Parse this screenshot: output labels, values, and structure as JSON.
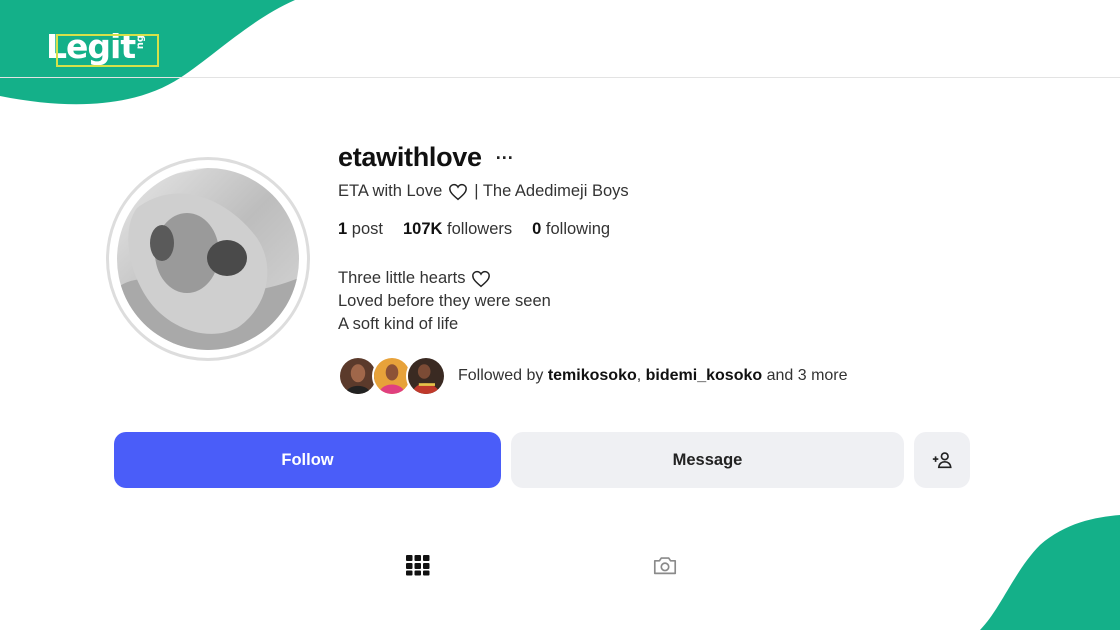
{
  "brand": {
    "logo_text": "Legit",
    "logo_suffix": "ng",
    "brand_color": "#14b089",
    "accent_frame_color": "#d6e14a"
  },
  "profile": {
    "username": "etawithlove",
    "more_label": "···",
    "full_name": "ETA with Love",
    "full_name_suffix": "| The Adedimeji Boys",
    "stats": {
      "posts_count": "1",
      "posts_label": "post",
      "followers_count": "107K",
      "followers_label": "followers",
      "following_count": "0",
      "following_label": "following"
    },
    "bio": {
      "line1": "Three little hearts",
      "line2": "Loved before they were seen",
      "line3": "A soft kind of life"
    },
    "followed_by": {
      "prefix": "Followed by",
      "user1": "temikosoko",
      "separator": ",",
      "user2": "bidemi_kosoko",
      "suffix": "and 3 more"
    }
  },
  "actions": {
    "follow_label": "Follow",
    "message_label": "Message",
    "suggest_icon": "person-add-icon",
    "follow_color": "#4a5df9"
  },
  "tabs": [
    {
      "icon": "grid-icon"
    },
    {
      "icon": "tagged-camera-icon"
    }
  ]
}
